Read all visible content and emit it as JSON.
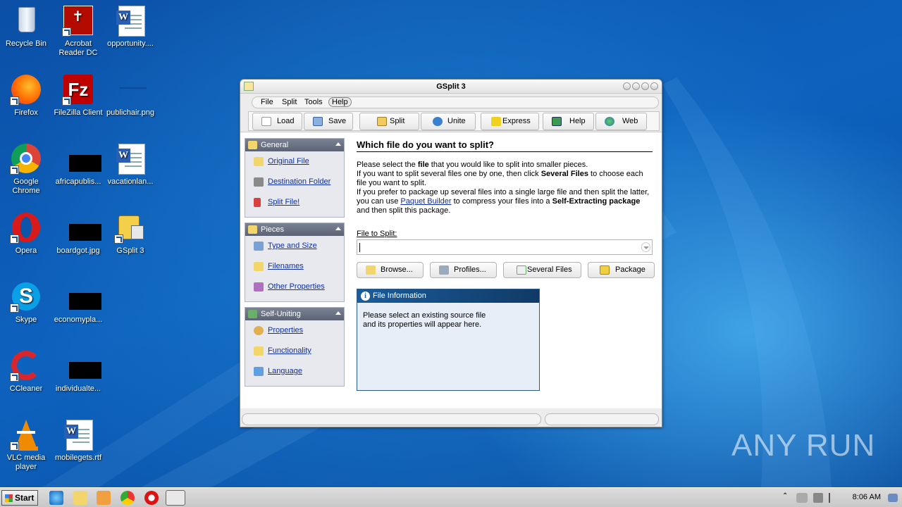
{
  "desktop": {
    "icons": [
      {
        "label": "Recycle Bin",
        "icon": "recycle-bin-icon"
      },
      {
        "label": "Acrobat Reader DC",
        "icon": "acrobat-icon"
      },
      {
        "label": "opportunity....",
        "icon": "word-doc-icon"
      },
      {
        "label": "Firefox",
        "icon": "firefox-icon"
      },
      {
        "label": "FileZilla Client",
        "icon": "filezilla-icon"
      },
      {
        "label": "publichair.png",
        "icon": "png-file-icon"
      },
      {
        "label": "Google Chrome",
        "icon": "chrome-icon"
      },
      {
        "label": "africapublis...",
        "icon": "black-file-icon"
      },
      {
        "label": "vacationlan...",
        "icon": "word-doc-icon"
      },
      {
        "label": "Opera",
        "icon": "opera-icon"
      },
      {
        "label": "boardgot.jpg",
        "icon": "black-file-icon"
      },
      {
        "label": "GSplit 3",
        "icon": "gsplit-icon"
      },
      {
        "label": "Skype",
        "icon": "skype-icon"
      },
      {
        "label": "economypla...",
        "icon": "black-file-icon"
      },
      {
        "label": "CCleaner",
        "icon": "ccleaner-icon"
      },
      {
        "label": "individualte...",
        "icon": "black-file-icon"
      },
      {
        "label": "VLC media player",
        "icon": "vlc-icon"
      },
      {
        "label": "mobilegets.rtf",
        "icon": "word-doc-icon"
      }
    ],
    "watermark": "ANY RUN"
  },
  "window": {
    "title": "GSplit 3",
    "menu": [
      "File",
      "Split",
      "Tools",
      "Help"
    ],
    "toolbar": [
      {
        "label": "Load",
        "icon": "load-icon"
      },
      {
        "label": "Save",
        "icon": "save-icon"
      },
      {
        "label": "Split",
        "icon": "split-icon"
      },
      {
        "label": "Unite",
        "icon": "unite-icon"
      },
      {
        "label": "Express",
        "icon": "express-icon"
      },
      {
        "label": "Help",
        "icon": "help-book-icon"
      },
      {
        "label": "Web",
        "icon": "globe-icon"
      }
    ],
    "sidebar": [
      {
        "title": "General",
        "items": [
          "Original File",
          "Destination Folder",
          "Split File!"
        ]
      },
      {
        "title": "Pieces",
        "items": [
          "Type and Size",
          "Filenames",
          "Other Properties"
        ]
      },
      {
        "title": "Self-Uniting",
        "items": [
          "Properties",
          "Functionality",
          "Language"
        ]
      }
    ],
    "main": {
      "heading": "Which file do you want to split?",
      "p1a": "Please select the ",
      "p1b": "file",
      "p1c": " that you would like to split into smaller pieces.",
      "p2a": "If you want to split several files one by one, then click ",
      "p2b": "Several Files",
      "p2c": " to choose each file you want to split.",
      "p3a": "If you prefer to package up several files into a single large file and then split the latter, you can use ",
      "p3link": "Paquet Builder",
      "p3b": " to compress your files into a ",
      "p3c": "Self-Extracting package",
      "p3d": " and then split this package.",
      "file_label": "File to Split:",
      "file_value": "",
      "buttons": [
        "Browse...",
        "Profiles...",
        "Several Files",
        "Package"
      ],
      "info_title": "File Information",
      "info_text": "Please select an existing source file and its properties will appear here."
    }
  },
  "taskbar": {
    "start": "Start",
    "clock": "8:06 AM"
  }
}
